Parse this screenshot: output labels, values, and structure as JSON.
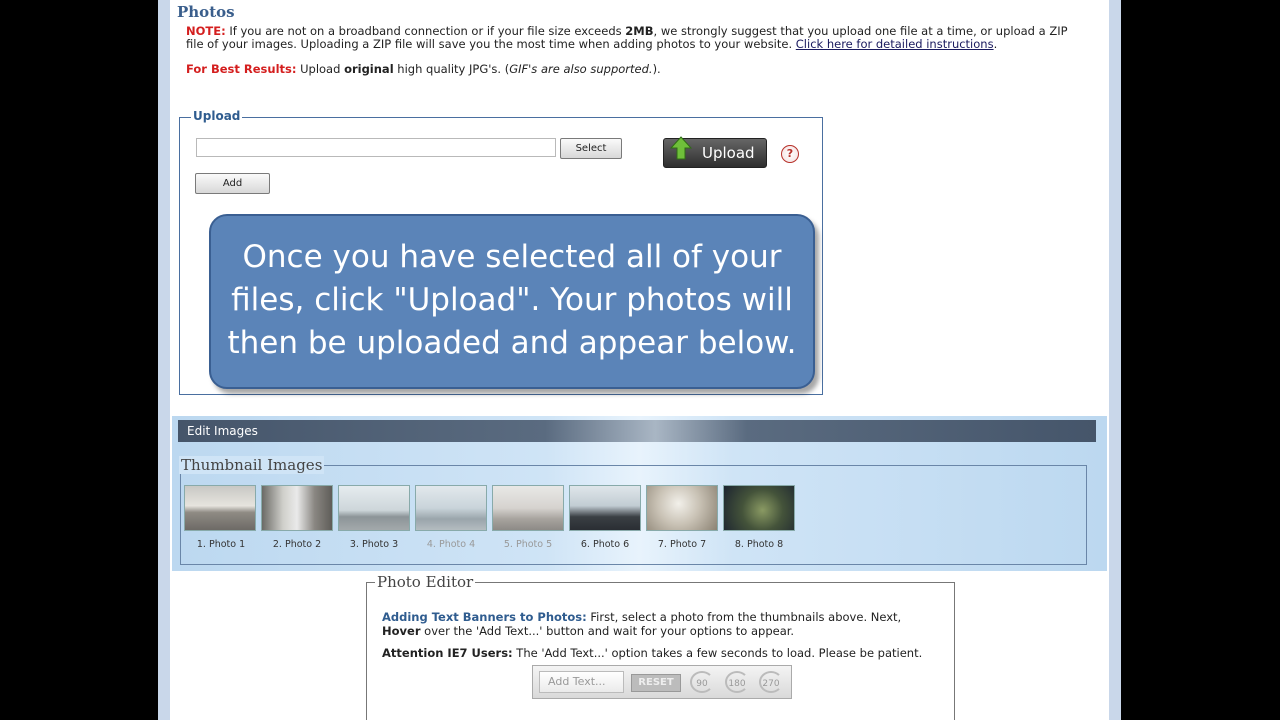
{
  "page": {
    "title": "Photos",
    "note_label": "NOTE:",
    "note_text": " If you are not on a broadband connection or if your file size exceeds ",
    "note_size": "2MB",
    "note_text2": ", we strongly suggest that you upload one file at a time, or upload a ZIP file of your images. Uploading a ZIP file will save you the most time when adding photos to your website. ",
    "note_link": "Click here for detailed instructions",
    "note_end": ".",
    "best_label": "For Best Results:",
    "best_text1": " Upload ",
    "best_bold": "original",
    "best_text2": " high quality JPG's. (",
    "best_italic": "GIF's are also supported.",
    "best_end": ")."
  },
  "upload": {
    "legend": "Upload",
    "file_value": "",
    "select_label": "Select",
    "add_label": "Add",
    "upload_label": "Upload",
    "help_label": "?",
    "callout": "Once you have selected all of your files, click \"Upload\". Your photos will then be uploaded and appear below."
  },
  "edit": {
    "header": "Edit Images",
    "thumb_legend": "Thumbnail Images",
    "thumbnails": [
      {
        "caption": "1. Photo 1"
      },
      {
        "caption": "2. Photo 2"
      },
      {
        "caption": "3. Photo 3"
      },
      {
        "caption": "4. Photo 4"
      },
      {
        "caption": "5. Photo 5"
      },
      {
        "caption": "6. Photo 6"
      },
      {
        "caption": "7. Photo 7"
      },
      {
        "caption": "8. Photo 8"
      }
    ]
  },
  "editor": {
    "legend": "Photo Editor",
    "banner_label": "Adding Text Banners to Photos:",
    "banner_text": " First, select a photo from the thumbnails above. Next, ",
    "hover_label": "Hover",
    "hover_text": " over the 'Add Text...' button and wait for your options to appear.",
    "attn_label": "Attention IE7 Users:",
    "attn_text": " The 'Add Text...' option takes a few seconds to load. Please be patient.",
    "add_text_label": "Add Text...",
    "reset_label": "RESET",
    "rotate_90": "90",
    "rotate_180": "180",
    "rotate_270": "270"
  }
}
